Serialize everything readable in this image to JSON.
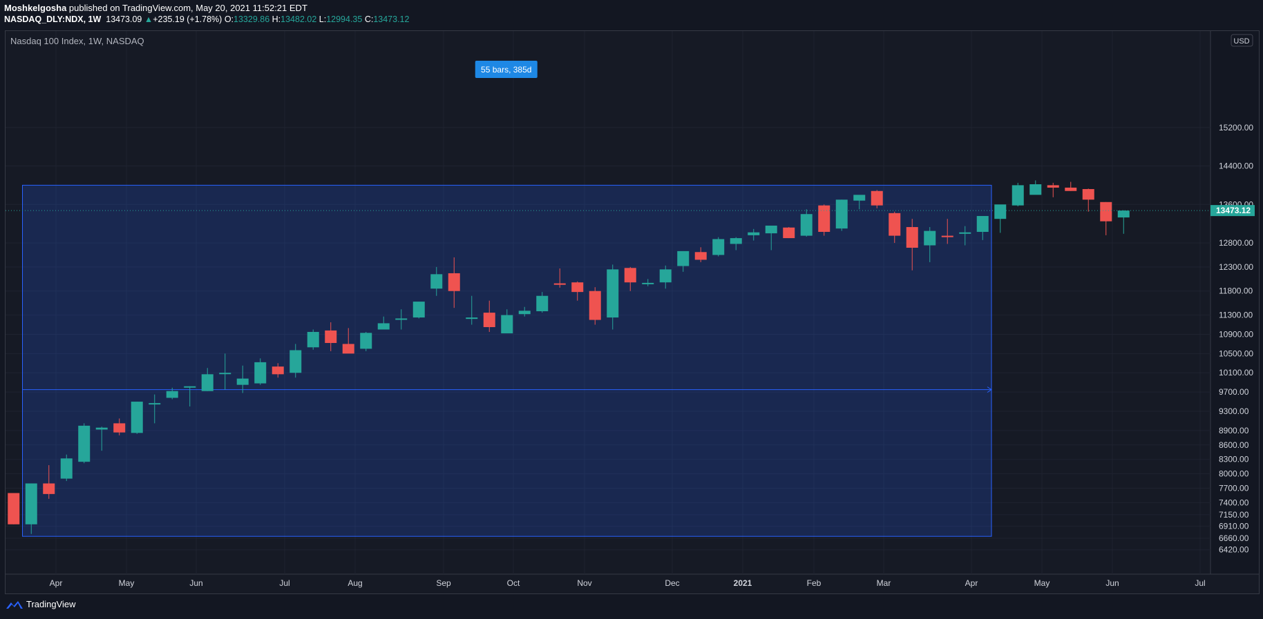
{
  "header": {
    "author": "Moshkelgosha",
    "published": "published on TradingView.com, May 20, 2021 11:52:21 EDT",
    "symbol": "NASDAQ_DLY:NDX, 1W",
    "last": "13473.09",
    "change": "+235.19 (+1.78%)",
    "o_label": "O:",
    "o": "13329.86",
    "h_label": "H:",
    "h": "13482.02",
    "l_label": "L:",
    "l": "12994.35",
    "c_label": "C:",
    "c": "13473.12"
  },
  "footer": {
    "brand": "TradingView"
  },
  "colors": {
    "up": "#26a69a",
    "down": "#ef5350",
    "range": "#2962ff",
    "badge": "#1e88e5"
  },
  "chart_data": {
    "type": "candlestick",
    "title": "Nasdaq 100 Index, 1W, NASDAQ",
    "currency": "USD",
    "last_price_label": "13473.12",
    "y_ticks": [
      "6420.00",
      "6660.00",
      "6910.00",
      "7150.00",
      "7400.00",
      "7700.00",
      "8000.00",
      "8300.00",
      "8600.00",
      "8900.00",
      "9300.00",
      "9700.00",
      "10100.00",
      "10500.00",
      "10900.00",
      "11300.00",
      "11800.00",
      "12300.00",
      "12800.00",
      "13600.00",
      "14400.00",
      "15200.00"
    ],
    "x_ticks": [
      "Apr",
      "May",
      "Jun",
      "Jul",
      "Aug",
      "Sep",
      "Oct",
      "Nov",
      "Dec",
      "2021",
      "Feb",
      "Mar",
      "Apr",
      "May",
      "Jun",
      "Jul"
    ],
    "ylim": [
      6300,
      15400
    ],
    "grid": true,
    "candles": [
      {
        "o": 7600,
        "h": 7600,
        "l": 6950,
        "c": 6950
      },
      {
        "o": 6950,
        "h": 7800,
        "l": 6750,
        "c": 7800
      },
      {
        "o": 7800,
        "h": 8180,
        "l": 7480,
        "c": 7580
      },
      {
        "o": 7900,
        "h": 8400,
        "l": 7850,
        "c": 8320
      },
      {
        "o": 8250,
        "h": 9050,
        "l": 8220,
        "c": 9000
      },
      {
        "o": 8920,
        "h": 8980,
        "l": 8480,
        "c": 8960
      },
      {
        "o": 9050,
        "h": 9150,
        "l": 8800,
        "c": 8860
      },
      {
        "o": 8850,
        "h": 9500,
        "l": 8830,
        "c": 9500
      },
      {
        "o": 9470,
        "h": 9650,
        "l": 9050,
        "c": 9470
      },
      {
        "o": 9580,
        "h": 9790,
        "l": 9550,
        "c": 9720
      },
      {
        "o": 9820,
        "h": 9820,
        "l": 9400,
        "c": 9820
      },
      {
        "o": 9720,
        "h": 10200,
        "l": 9720,
        "c": 10070
      },
      {
        "o": 10100,
        "h": 10500,
        "l": 9750,
        "c": 10100
      },
      {
        "o": 9850,
        "h": 10250,
        "l": 9680,
        "c": 9980
      },
      {
        "o": 9880,
        "h": 10400,
        "l": 9850,
        "c": 10320
      },
      {
        "o": 10230,
        "h": 10300,
        "l": 10000,
        "c": 10070
      },
      {
        "o": 10100,
        "h": 10700,
        "l": 10000,
        "c": 10570
      },
      {
        "o": 10630,
        "h": 11000,
        "l": 10580,
        "c": 10950
      },
      {
        "o": 10980,
        "h": 11150,
        "l": 10550,
        "c": 10720
      },
      {
        "o": 10700,
        "h": 11030,
        "l": 10550,
        "c": 10500
      },
      {
        "o": 10600,
        "h": 10950,
        "l": 10550,
        "c": 10930
      },
      {
        "o": 11000,
        "h": 11270,
        "l": 11010,
        "c": 11130
      },
      {
        "o": 11230,
        "h": 11420,
        "l": 11000,
        "c": 11230
      },
      {
        "o": 11250,
        "h": 11580,
        "l": 11230,
        "c": 11580
      },
      {
        "o": 11850,
        "h": 12300,
        "l": 11700,
        "c": 12150
      },
      {
        "o": 12170,
        "h": 12500,
        "l": 11450,
        "c": 11800
      },
      {
        "o": 11220,
        "h": 11700,
        "l": 11100,
        "c": 11250
      },
      {
        "o": 11350,
        "h": 11600,
        "l": 10950,
        "c": 11050
      },
      {
        "o": 10920,
        "h": 11420,
        "l": 10930,
        "c": 11300
      },
      {
        "o": 11320,
        "h": 11470,
        "l": 11270,
        "c": 11390
      },
      {
        "o": 11380,
        "h": 11780,
        "l": 11350,
        "c": 11700
      },
      {
        "o": 11960,
        "h": 12270,
        "l": 11870,
        "c": 11930
      },
      {
        "o": 11980,
        "h": 12000,
        "l": 11600,
        "c": 11780
      },
      {
        "o": 11800,
        "h": 11880,
        "l": 11100,
        "c": 11200
      },
      {
        "o": 11250,
        "h": 12350,
        "l": 11000,
        "c": 12250
      },
      {
        "o": 12280,
        "h": 12300,
        "l": 11800,
        "c": 11980
      },
      {
        "o": 11970,
        "h": 12050,
        "l": 11900,
        "c": 11970
      },
      {
        "o": 11980,
        "h": 12330,
        "l": 11850,
        "c": 12250
      },
      {
        "o": 12320,
        "h": 12630,
        "l": 12200,
        "c": 12630
      },
      {
        "o": 12610,
        "h": 12710,
        "l": 12400,
        "c": 12450
      },
      {
        "o": 12550,
        "h": 12920,
        "l": 12520,
        "c": 12880
      },
      {
        "o": 12780,
        "h": 12920,
        "l": 12650,
        "c": 12900
      },
      {
        "o": 12960,
        "h": 13090,
        "l": 12850,
        "c": 13020
      },
      {
        "o": 13000,
        "h": 13100,
        "l": 12650,
        "c": 13160
      },
      {
        "o": 13120,
        "h": 13130,
        "l": 12900,
        "c": 12900
      },
      {
        "o": 12950,
        "h": 13500,
        "l": 12930,
        "c": 13400
      },
      {
        "o": 13580,
        "h": 13600,
        "l": 12950,
        "c": 13030
      },
      {
        "o": 13100,
        "h": 13700,
        "l": 13050,
        "c": 13700
      },
      {
        "o": 13680,
        "h": 13780,
        "l": 13500,
        "c": 13800
      },
      {
        "o": 13880,
        "h": 13900,
        "l": 13520,
        "c": 13580
      },
      {
        "o": 13420,
        "h": 13450,
        "l": 12800,
        "c": 12950
      },
      {
        "o": 13130,
        "h": 13300,
        "l": 12230,
        "c": 12700
      },
      {
        "o": 12750,
        "h": 13130,
        "l": 12400,
        "c": 13050
      },
      {
        "o": 12950,
        "h": 13300,
        "l": 12780,
        "c": 12920
      },
      {
        "o": 12990,
        "h": 13150,
        "l": 12750,
        "c": 13020
      },
      {
        "o": 13030,
        "h": 13200,
        "l": 12860,
        "c": 13360
      },
      {
        "o": 13300,
        "h": 13500,
        "l": 13010,
        "c": 13600
      },
      {
        "o": 13580,
        "h": 14050,
        "l": 13560,
        "c": 14000
      },
      {
        "o": 13800,
        "h": 14100,
        "l": 13820,
        "c": 14020
      },
      {
        "o": 14000,
        "h": 14050,
        "l": 13750,
        "c": 13950
      },
      {
        "o": 13950,
        "h": 14070,
        "l": 13880,
        "c": 13880
      },
      {
        "o": 13920,
        "h": 13930,
        "l": 13450,
        "c": 13700
      },
      {
        "o": 13650,
        "h": 13650,
        "l": 12960,
        "c": 13250
      },
      {
        "o": 13330,
        "h": 13480,
        "l": 12990,
        "c": 13473
      }
    ],
    "measure": {
      "label": "55 bars, 385d",
      "from_bar": 1,
      "to_bar": 56,
      "price_low": 6700,
      "price_high": 14000,
      "arrow_price": 9750
    }
  }
}
